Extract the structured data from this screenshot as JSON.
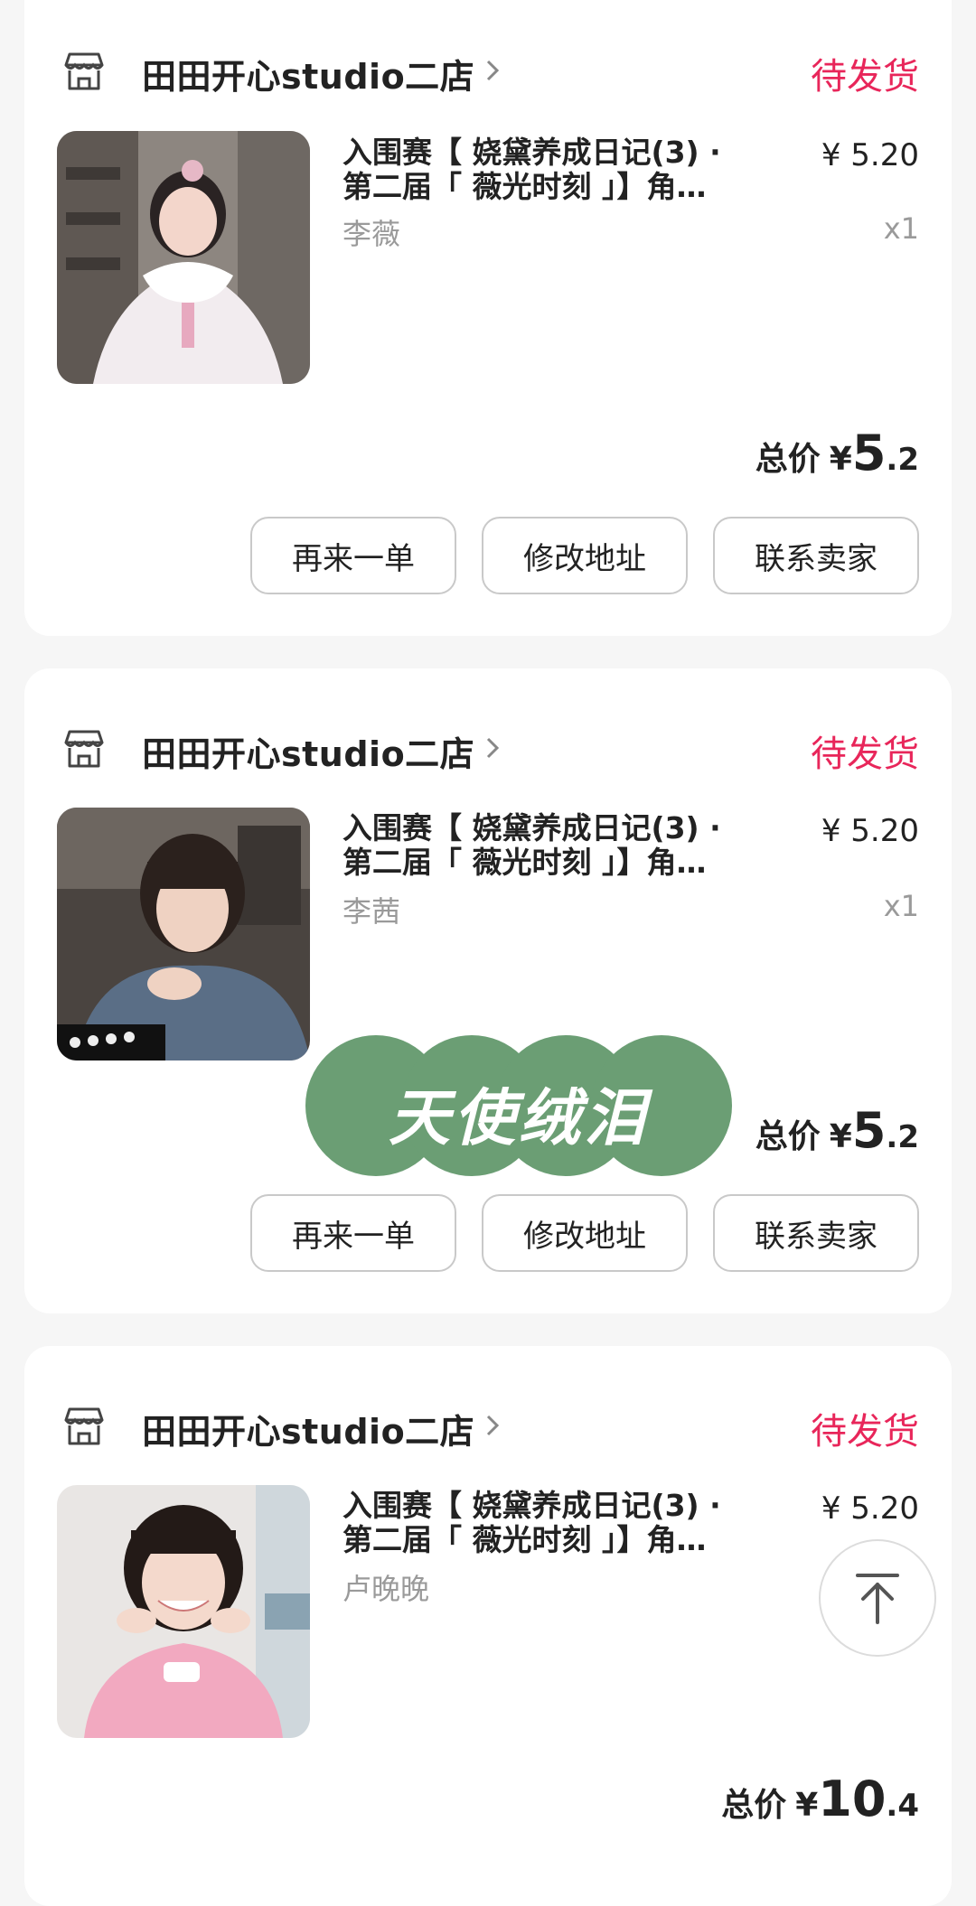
{
  "colors": {
    "accent": "#e8265a",
    "badge_green": "#6b9e74",
    "muted": "#9a9a9a"
  },
  "orders": [
    {
      "shop_name": "田田开心studio二店",
      "shop_icon": "store-icon",
      "status": "待发货",
      "product": {
        "title_line1": "入围赛【 娆黛养成日记(3) ·",
        "title_line2": "第二届「 薇光时刻 」】角…",
        "price": "¥ 5.20",
        "spec": "李薇",
        "qty": "x1"
      },
      "total": {
        "label": "总价",
        "currency": "¥",
        "int": "5",
        "dec": ".2"
      },
      "actions": [
        "再来一单",
        "修改地址",
        "联系卖家"
      ]
    },
    {
      "shop_name": "田田开心studio二店",
      "shop_icon": "store-icon",
      "status": "待发货",
      "product": {
        "title_line1": "入围赛【 娆黛养成日记(3) ·",
        "title_line2": "第二届「 薇光时刻 」】角…",
        "price": "¥ 5.20",
        "spec": "李茜",
        "qty": "x1"
      },
      "total": {
        "label": "总价",
        "currency": "¥",
        "int": "5",
        "dec": ".2"
      },
      "actions": [
        "再来一单",
        "修改地址",
        "联系卖家"
      ]
    },
    {
      "shop_name": "田田开心studio二店",
      "shop_icon": "store-icon",
      "status": "待发货",
      "product": {
        "title_line1": "入围赛【 娆黛养成日记(3) ·",
        "title_line2": "第二届「 薇光时刻 」】角…",
        "price": "¥ 5.20",
        "spec": "卢晚晚"
      },
      "total": {
        "label": "总价",
        "currency": "¥",
        "int": "10",
        "dec": ".4"
      }
    }
  ],
  "promo_badge": {
    "text": "天使绒泪"
  },
  "floating": {
    "back_to_top_icon": "arrow-up-to-top-icon"
  }
}
